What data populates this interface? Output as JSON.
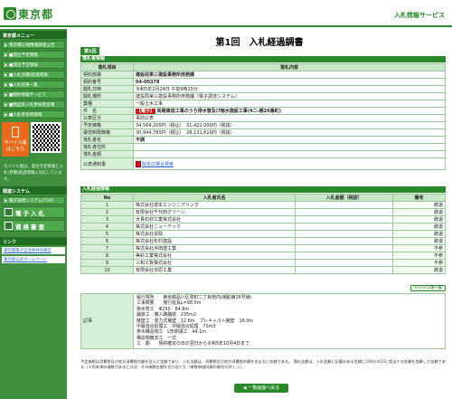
{
  "header": {
    "logo_text": "東京都",
    "service_title": "入札情報サービス"
  },
  "sidebar": {
    "menu_head": "東京都メニュー",
    "items": [
      {
        "label": "東京都公報情報調達公告"
      },
      {
        "label": "■発注予定情報"
      },
      {
        "label": "■発注予定情報"
      },
      {
        "label": "■入札見積)結過情報"
      },
      {
        "label": "■入札結果一覧"
      },
      {
        "label": "■物件情報サービス"
      },
      {
        "label": "■物品等入札参加者名簿"
      },
      {
        "label": "■入札参加者情報"
      }
    ],
    "mobile_badge": "モバイル版",
    "mobile_badge_sub": "はこちら",
    "mobile_note": "モバイル版は、発注予定情報と入札(見積)結過情報に対応しています。",
    "system_head": "関連システム",
    "system_item": "電子調達システム(TOP)",
    "big_items": [
      {
        "label": "電子入札"
      },
      {
        "label": "資格審査"
      }
    ],
    "link_head": "リンク",
    "links": [
      {
        "label": "東京都電子自治体共同運営"
      },
      {
        "label": "東京都公式ホームページ"
      }
    ]
  },
  "main": {
    "page_title": "第1回　入札経過調書",
    "tab_label": "第1回",
    "section_case": "落札者情報",
    "case_header": {
      "col1": "落札項目",
      "col2": "落札内容"
    },
    "case_rows": [
      {
        "label": "契約部署",
        "value": "建設局第三建設事務所庶務課"
      },
      {
        "label": "契約番号",
        "value": "04-00378"
      },
      {
        "label": "開札日時",
        "value": "令和5年2月24日 午前9時15分"
      },
      {
        "label": "開札場所",
        "value": "建設局第三建設事務所庶務課（電子調達システム）"
      },
      {
        "label": "業種",
        "value": "一般土木工事"
      },
      {
        "label": "件　名",
        "tag": "【電子】",
        "value": "街路築造工事のうち排水管及び雨水施設工事(4二-補26番町)"
      },
      {
        "label": "公表区分",
        "value": "事前公表"
      },
      {
        "label": "予定価格",
        "value": "34,564,200円（税込）　31,422,000円（税抜）"
      },
      {
        "label": "最低制限価格",
        "value": "30,944,780円（税込）　28,131,619円（税抜）"
      },
      {
        "label": "落札者名",
        "value": "不調"
      },
      {
        "label": "落札者住所",
        "value": ""
      },
      {
        "label": "落札金額",
        "value": ""
      },
      {
        "label": "公表通知書",
        "value": "取名の場合検索"
      }
    ],
    "section_bids": "入札経過情報",
    "bids_header": {
      "no": "No",
      "name": "入札者氏名",
      "amount": "入札金額（税抜）",
      "note": "備考"
    },
    "bids": [
      {
        "no": "1",
        "name": "株式会社境本エンジニアリング",
        "amount": "",
        "note": "辞退"
      },
      {
        "no": "2",
        "name": "有限会社千代田グリーン",
        "amount": "",
        "note": "辞退"
      },
      {
        "no": "3",
        "name": "大貴石材工業株式会社",
        "amount": "",
        "note": "辞退"
      },
      {
        "no": "4",
        "name": "株式会社ニューテック",
        "amount": "",
        "note": "辞退"
      },
      {
        "no": "5",
        "name": "株式会社栄興",
        "amount": "",
        "note": "辞退"
      },
      {
        "no": "6",
        "name": "株式会社松村建設",
        "amount": "",
        "note": "辞退"
      },
      {
        "no": "7",
        "name": "株式会社浜田建工業",
        "amount": "",
        "note": "不参"
      },
      {
        "no": "8",
        "name": "美鈴工業株式会社",
        "amount": "",
        "note": "不参"
      },
      {
        "no": "9",
        "name": "三和工質株式会社",
        "amount": "",
        "note": "不参"
      },
      {
        "no": "10",
        "name": "有限会社日原工業",
        "amount": "",
        "note": "辞退"
      }
    ],
    "pager_label": "ハッシュ値一覧",
    "remarks_label": "記事",
    "remarks": "履行場所　　東京都品川区豊町二丁目地内(補助第26号線)\n工事概要　　施行延長L=98.5m\n排水管工　Φ250　84.8m\n舗装工　撤入路舗装　235m2\n擁壁工　重力式擁壁　12.6m　プレキャスト擁壁　16.0m\n中層混合処理工　中層混合処理　73m3\n排水構造物工　L形側溝工　44.1m\n構造物撤去工　一式\n工　期　　契約確定の日の翌日から令和5年10月4日まで",
    "footnote": "予定価格は消費税及び地方消費税の額を含んだ金額であり、入札金額は、消費税及び地方消費税の額を含まない金額である。\n落札金額は、入札金額に記載のある金額に100分の10に相当する金額を加算した金額である（１円未満の端数があるときは、その端数金額を切り捨てた（単数単価同様の場合も除く。））。",
    "back_button": "◀ 一覧画面へ戻る"
  }
}
